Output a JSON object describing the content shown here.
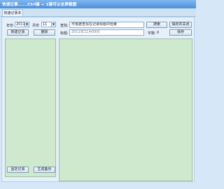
{
  "window": {
    "title": "快速记事......Ctrl键 + 1键可以全屏截图"
  },
  "tabs": [
    {
      "label": "快速记事本"
    }
  ],
  "filters": {
    "year_label": "年份",
    "year_value": "2011",
    "month_label": "月份",
    "month_value": "11"
  },
  "left_buttons": {
    "new_note": "新建记事",
    "delete": "删除"
  },
  "search": {
    "label": "查找:",
    "value": "可根据查找在记录标题中检索",
    "button": "搜索",
    "save_close": "保存并关闭"
  },
  "title_row": {
    "label": "标题:",
    "value": "2011年11月09日",
    "char_count_label": "字数:",
    "char_count_value": "0",
    "save": "保存"
  },
  "bottom_buttons": {
    "pin_note": "固定记事",
    "backup": "生成备份"
  }
}
